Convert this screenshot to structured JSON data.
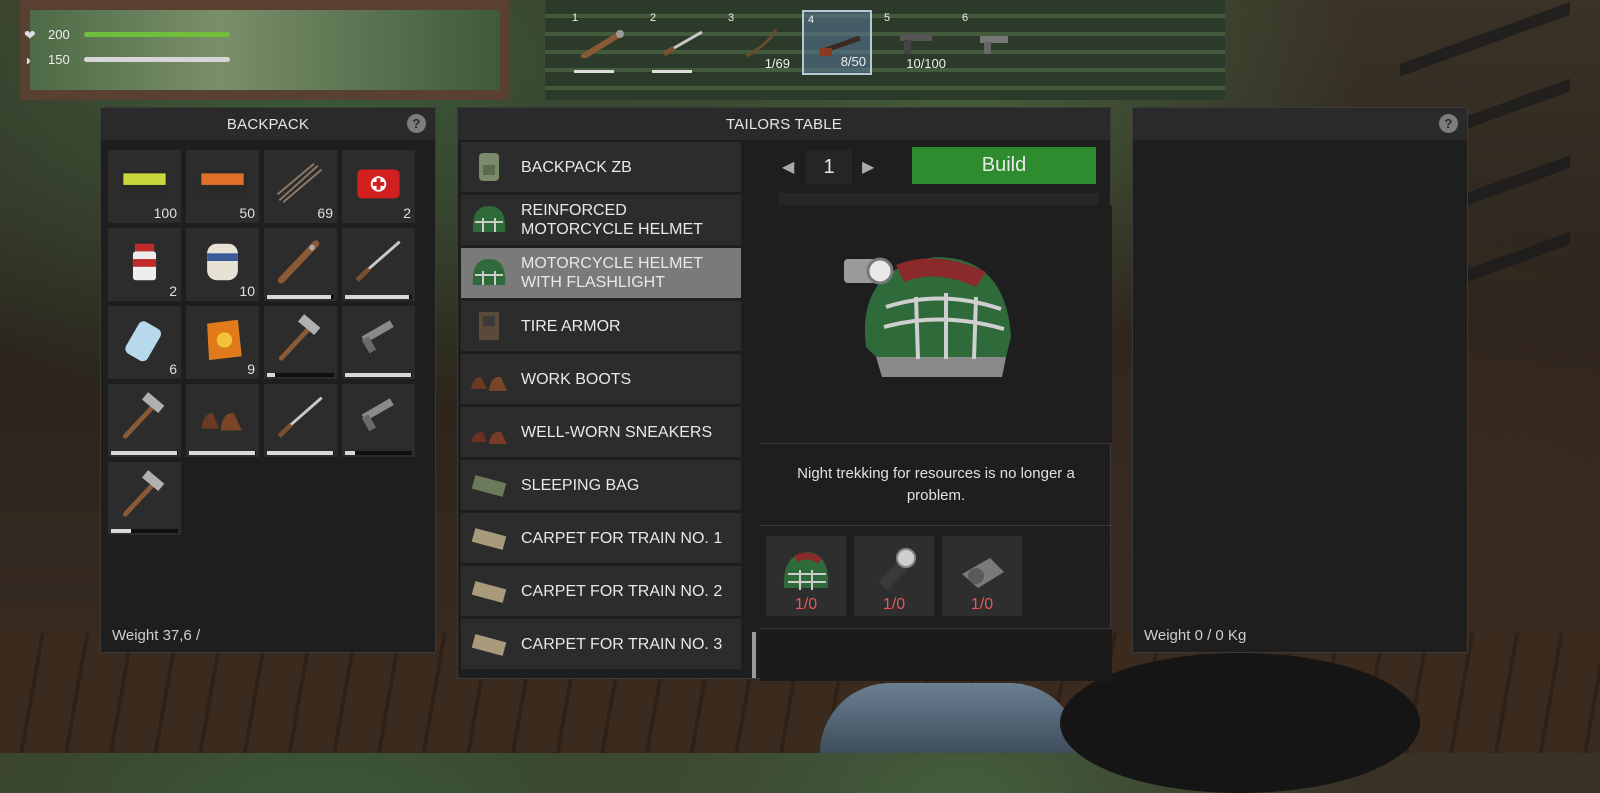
{
  "status": {
    "health": {
      "icon": "heart-icon",
      "value": "200",
      "fill": 1.0,
      "color": "#6fbf3a"
    },
    "hunger": {
      "icon": "stomach-icon",
      "value": "150",
      "fill": 1.0,
      "color": "#d6d6d6"
    }
  },
  "hotbar": [
    {
      "num": "1",
      "count": "",
      "item": "spiked-club"
    },
    {
      "num": "2",
      "count": "",
      "item": "knife"
    },
    {
      "num": "3",
      "count": "1/69",
      "item": "bow"
    },
    {
      "num": "4",
      "count": "8/50",
      "item": "shotgun",
      "selected": true
    },
    {
      "num": "5",
      "count": "10/100",
      "item": "pistol"
    },
    {
      "num": "6",
      "count": "",
      "item": "handgun"
    }
  ],
  "backpack": {
    "title": "BACKPACK",
    "help": "?",
    "weight": "Weight 37,6 /",
    "items": [
      {
        "name": "ammo-box-green",
        "qty": "100"
      },
      {
        "name": "ammo-box-orange",
        "qty": "50"
      },
      {
        "name": "arrows",
        "qty": "69"
      },
      {
        "name": "first-aid-kit",
        "qty": "2"
      },
      {
        "name": "pills-bottle",
        "qty": "2"
      },
      {
        "name": "bandage",
        "qty": "10"
      },
      {
        "name": "spiked-club",
        "durability": 0.95
      },
      {
        "name": "knife",
        "durability": 0.95
      },
      {
        "name": "water-bottle",
        "qty": "6"
      },
      {
        "name": "chips-bag",
        "qty": "9"
      },
      {
        "name": "hammer",
        "durability": 0.12
      },
      {
        "name": "pistol",
        "durability": 0.98
      },
      {
        "name": "hammer",
        "durability": 0.98
      },
      {
        "name": "boots",
        "durability": 0.98
      },
      {
        "name": "knife",
        "durability": 0.98
      },
      {
        "name": "pistol",
        "durability": 0.15
      },
      {
        "name": "hammer",
        "durability": 0.3
      }
    ]
  },
  "tailors": {
    "title": "TAILORS TABLE",
    "recipes": [
      {
        "name": "BACKPACK ZB",
        "icon": "backpack-icon"
      },
      {
        "name": "REINFORCED\nMOTORCYCLE HELMET",
        "icon": "helmet-icon"
      },
      {
        "name": "MOTORCYCLE HELMET\nWITH FLASHLIGHT",
        "icon": "helmet-icon",
        "selected": true
      },
      {
        "name": "TIRE ARMOR",
        "icon": "armor-icon"
      },
      {
        "name": "WORK BOOTS",
        "icon": "boots-icon"
      },
      {
        "name": "WELL-WORN SNEAKERS",
        "icon": "sneakers-icon"
      },
      {
        "name": "SLEEPING BAG",
        "icon": "sleeping-bag-icon"
      },
      {
        "name": "CARPET FOR TRAIN NO. 1",
        "icon": "carpet-icon"
      },
      {
        "name": "CARPET FOR TRAIN NO. 2",
        "icon": "carpet-icon"
      },
      {
        "name": "CARPET FOR TRAIN NO. 3",
        "icon": "carpet-icon"
      }
    ],
    "quantity": "1",
    "build_label": "Build",
    "build_color": "#2e8c2e",
    "description": "Night trekking for resources is no longer a problem.",
    "requirements": [
      {
        "item": "helmet",
        "count": "1/0"
      },
      {
        "item": "flashlight",
        "count": "1/0"
      },
      {
        "item": "duct-tape",
        "count": "1/0"
      }
    ]
  },
  "storage": {
    "help": "?",
    "weight": "Weight 0 / 0 Kg"
  }
}
